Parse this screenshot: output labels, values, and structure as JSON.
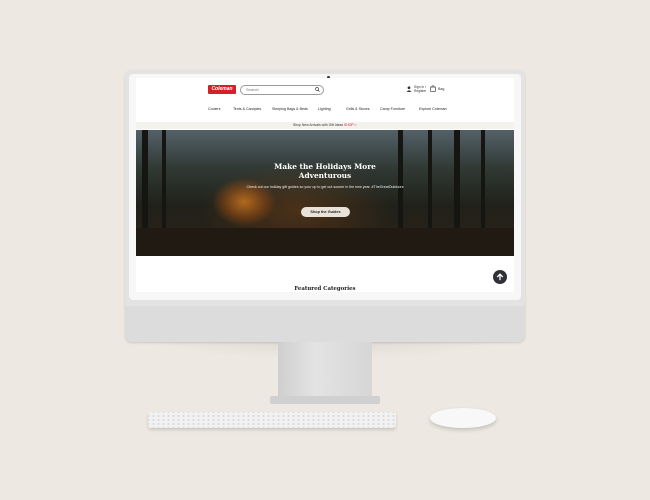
{
  "site": {
    "logo_text": "Coleman",
    "search_placeholder": "Search",
    "account": {
      "line1": "Sign In /",
      "line2": "Register"
    },
    "bag_label": "Bag",
    "nav": [
      "Coolers",
      "Tents & Canopies",
      "Sleeping Bags & Beds",
      "Lighting",
      "Grills & Stoves",
      "Camp Furniture",
      "Explore Coleman"
    ],
    "promo": {
      "text": "Shop New Arrivals with Gift Ideas",
      "link": "SHOP >"
    },
    "hero": {
      "title": "Make the Holidays More Adventurous",
      "subtitle": "Check out our holiday gift guides so your up to get out sooner in the new year. #TheGreatOutdoors",
      "button": "Shop the Guides"
    },
    "featured_heading": "Featured Categories"
  },
  "colors": {
    "brand_red": "#d4202c",
    "background": "#ede9e2",
    "button_dark": "#2f3136"
  },
  "icons": {
    "search": "search-icon",
    "account": "user-icon",
    "bag": "bag-icon",
    "back_to_top": "arrow-up-icon"
  }
}
